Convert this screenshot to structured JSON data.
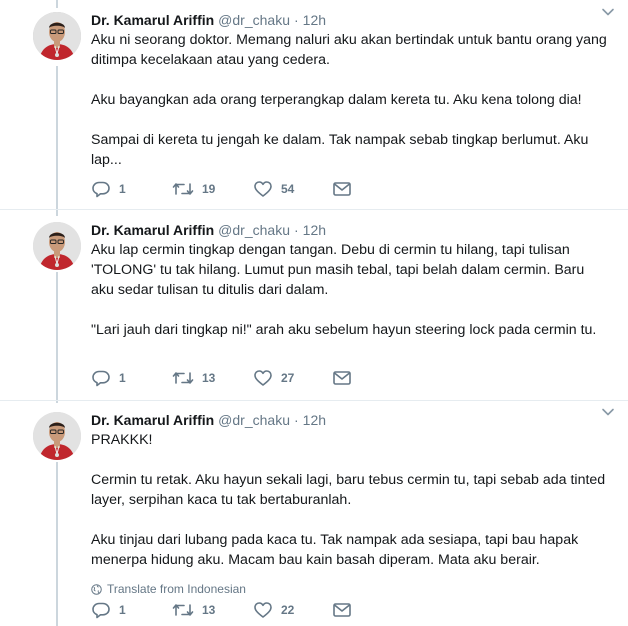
{
  "colors": {
    "text": "#14171a",
    "secondary": "#657786",
    "thread_line": "#ccd6dd",
    "divider": "#e6ecf0"
  },
  "tweets": [
    {
      "author_name": "Dr. Kamarul Ariffin",
      "handle": "@dr_chaku",
      "separator": "·",
      "time": "12h",
      "paragraphs": [
        "Aku ni seorang doktor. Memang naluri aku akan bertindak untuk bantu orang yang ditimpa kecelakaan atau yang cedera.",
        "Aku bayangkan ada orang terperangkap dalam kereta tu. Aku kena tolong dia!",
        "Sampai di kereta tu jengah ke dalam. Tak nampak sebab tingkap berlumut. Aku lap..."
      ],
      "replies": "1",
      "retweets": "19",
      "likes": "54"
    },
    {
      "author_name": "Dr. Kamarul Ariffin",
      "handle": "@dr_chaku",
      "separator": "·",
      "time": "12h",
      "paragraphs": [
        "Aku lap cermin tingkap dengan tangan. Debu di cermin tu hilang, tapi tulisan 'TOLONG' tu tak hilang. Lumut pun masih tebal, tapi belah dalam cermin. Baru aku sedar tulisan tu ditulis dari dalam.",
        "\"Lari jauh dari tingkap ni!\" arah aku sebelum hayun steering lock pada cermin tu."
      ],
      "replies": "1",
      "retweets": "13",
      "likes": "27"
    },
    {
      "author_name": "Dr. Kamarul Ariffin",
      "handle": "@dr_chaku",
      "separator": "·",
      "time": "12h",
      "paragraphs": [
        "PRAKKK!",
        "Cermin tu retak. Aku hayun sekali lagi, baru tebus cermin tu, tapi sebab ada tinted layer, serpihan kaca tu tak bertaburanlah.",
        "Aku tinjau dari lubang pada kaca tu. Tak nampak ada sesiapa, tapi bau hapak menerpa hidung aku. Macam bau kain basah diperam. Mata aku berair."
      ],
      "translate_label": "Translate from Indonesian",
      "replies": "1",
      "retweets": "13",
      "likes": "22"
    }
  ],
  "icons": {
    "reply": "reply-icon",
    "retweet": "retweet-icon",
    "like": "heart-icon",
    "message": "envelope-icon",
    "more": "chevron-down-icon",
    "translate": "globe-icon"
  }
}
